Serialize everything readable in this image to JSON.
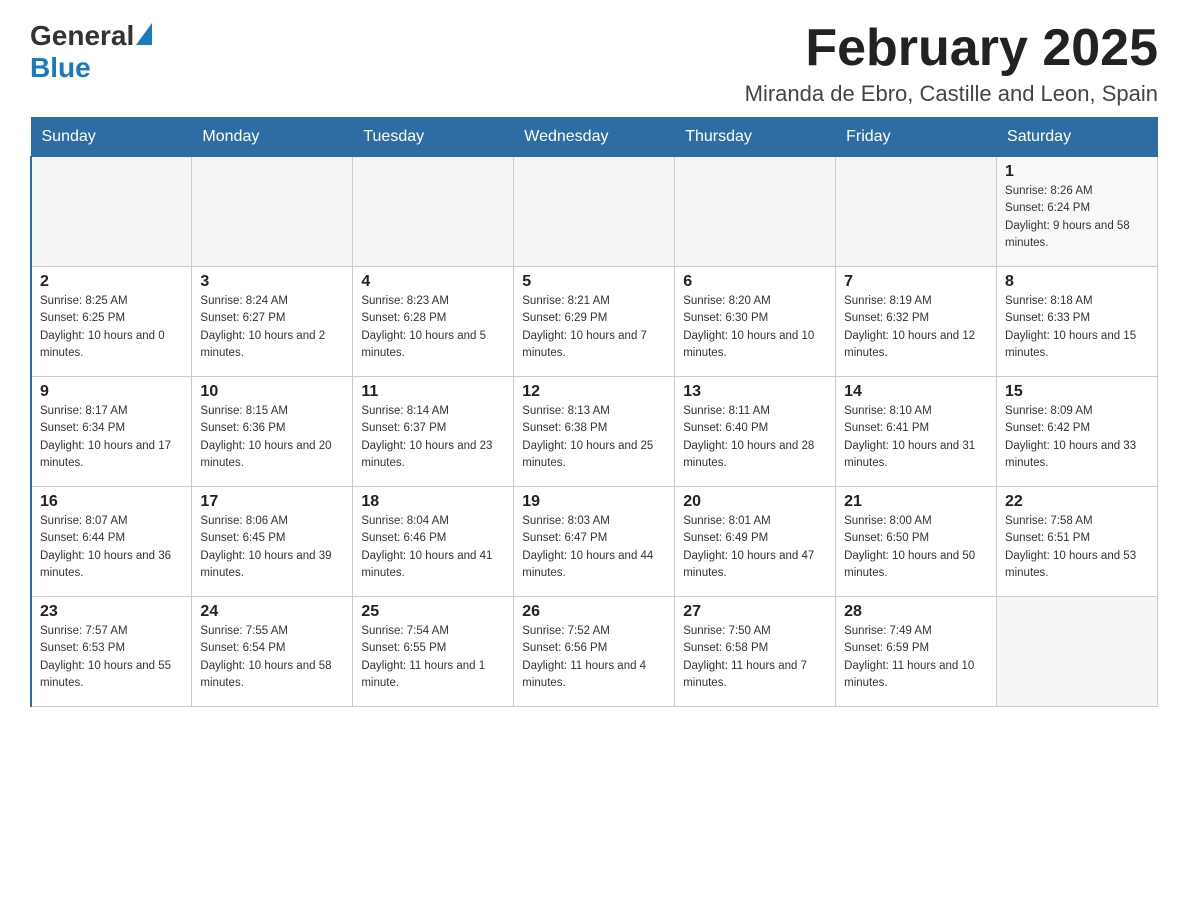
{
  "header": {
    "logo": {
      "general": "General",
      "blue": "Blue"
    },
    "title": "February 2025",
    "location": "Miranda de Ebro, Castille and Leon, Spain"
  },
  "weekdays": [
    "Sunday",
    "Monday",
    "Tuesday",
    "Wednesday",
    "Thursday",
    "Friday",
    "Saturday"
  ],
  "weeks": [
    [
      {
        "day": "",
        "info": ""
      },
      {
        "day": "",
        "info": ""
      },
      {
        "day": "",
        "info": ""
      },
      {
        "day": "",
        "info": ""
      },
      {
        "day": "",
        "info": ""
      },
      {
        "day": "",
        "info": ""
      },
      {
        "day": "1",
        "info": "Sunrise: 8:26 AM\nSunset: 6:24 PM\nDaylight: 9 hours and 58 minutes."
      }
    ],
    [
      {
        "day": "2",
        "info": "Sunrise: 8:25 AM\nSunset: 6:25 PM\nDaylight: 10 hours and 0 minutes."
      },
      {
        "day": "3",
        "info": "Sunrise: 8:24 AM\nSunset: 6:27 PM\nDaylight: 10 hours and 2 minutes."
      },
      {
        "day": "4",
        "info": "Sunrise: 8:23 AM\nSunset: 6:28 PM\nDaylight: 10 hours and 5 minutes."
      },
      {
        "day": "5",
        "info": "Sunrise: 8:21 AM\nSunset: 6:29 PM\nDaylight: 10 hours and 7 minutes."
      },
      {
        "day": "6",
        "info": "Sunrise: 8:20 AM\nSunset: 6:30 PM\nDaylight: 10 hours and 10 minutes."
      },
      {
        "day": "7",
        "info": "Sunrise: 8:19 AM\nSunset: 6:32 PM\nDaylight: 10 hours and 12 minutes."
      },
      {
        "day": "8",
        "info": "Sunrise: 8:18 AM\nSunset: 6:33 PM\nDaylight: 10 hours and 15 minutes."
      }
    ],
    [
      {
        "day": "9",
        "info": "Sunrise: 8:17 AM\nSunset: 6:34 PM\nDaylight: 10 hours and 17 minutes."
      },
      {
        "day": "10",
        "info": "Sunrise: 8:15 AM\nSunset: 6:36 PM\nDaylight: 10 hours and 20 minutes."
      },
      {
        "day": "11",
        "info": "Sunrise: 8:14 AM\nSunset: 6:37 PM\nDaylight: 10 hours and 23 minutes."
      },
      {
        "day": "12",
        "info": "Sunrise: 8:13 AM\nSunset: 6:38 PM\nDaylight: 10 hours and 25 minutes."
      },
      {
        "day": "13",
        "info": "Sunrise: 8:11 AM\nSunset: 6:40 PM\nDaylight: 10 hours and 28 minutes."
      },
      {
        "day": "14",
        "info": "Sunrise: 8:10 AM\nSunset: 6:41 PM\nDaylight: 10 hours and 31 minutes."
      },
      {
        "day": "15",
        "info": "Sunrise: 8:09 AM\nSunset: 6:42 PM\nDaylight: 10 hours and 33 minutes."
      }
    ],
    [
      {
        "day": "16",
        "info": "Sunrise: 8:07 AM\nSunset: 6:44 PM\nDaylight: 10 hours and 36 minutes."
      },
      {
        "day": "17",
        "info": "Sunrise: 8:06 AM\nSunset: 6:45 PM\nDaylight: 10 hours and 39 minutes."
      },
      {
        "day": "18",
        "info": "Sunrise: 8:04 AM\nSunset: 6:46 PM\nDaylight: 10 hours and 41 minutes."
      },
      {
        "day": "19",
        "info": "Sunrise: 8:03 AM\nSunset: 6:47 PM\nDaylight: 10 hours and 44 minutes."
      },
      {
        "day": "20",
        "info": "Sunrise: 8:01 AM\nSunset: 6:49 PM\nDaylight: 10 hours and 47 minutes."
      },
      {
        "day": "21",
        "info": "Sunrise: 8:00 AM\nSunset: 6:50 PM\nDaylight: 10 hours and 50 minutes."
      },
      {
        "day": "22",
        "info": "Sunrise: 7:58 AM\nSunset: 6:51 PM\nDaylight: 10 hours and 53 minutes."
      }
    ],
    [
      {
        "day": "23",
        "info": "Sunrise: 7:57 AM\nSunset: 6:53 PM\nDaylight: 10 hours and 55 minutes."
      },
      {
        "day": "24",
        "info": "Sunrise: 7:55 AM\nSunset: 6:54 PM\nDaylight: 10 hours and 58 minutes."
      },
      {
        "day": "25",
        "info": "Sunrise: 7:54 AM\nSunset: 6:55 PM\nDaylight: 11 hours and 1 minute."
      },
      {
        "day": "26",
        "info": "Sunrise: 7:52 AM\nSunset: 6:56 PM\nDaylight: 11 hours and 4 minutes."
      },
      {
        "day": "27",
        "info": "Sunrise: 7:50 AM\nSunset: 6:58 PM\nDaylight: 11 hours and 7 minutes."
      },
      {
        "day": "28",
        "info": "Sunrise: 7:49 AM\nSunset: 6:59 PM\nDaylight: 11 hours and 10 minutes."
      },
      {
        "day": "",
        "info": ""
      }
    ]
  ]
}
